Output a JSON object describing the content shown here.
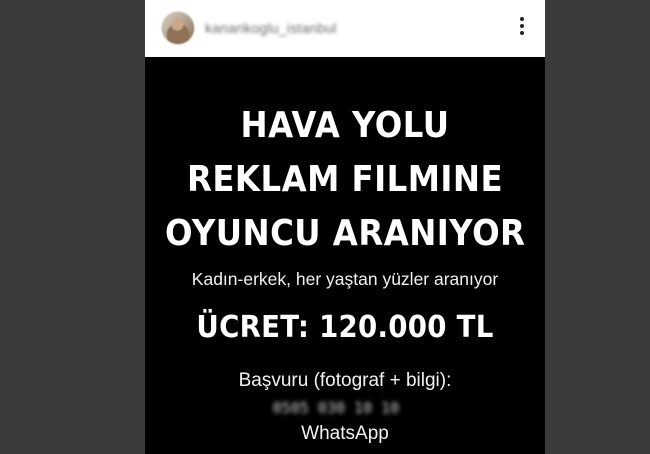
{
  "post": {
    "username": "kanarikoglu_istanbul",
    "menu_icon": "more-vertical-icon"
  },
  "ad": {
    "headline": [
      "HAVA YOLU",
      "REKLAM FILMINE",
      "OYUNCU ARANIYOR"
    ],
    "subtitle": "Kadın-erkek, her yaştan yüzler aranıyor",
    "price": "ÜCRET: 120.000 TL",
    "apply_label": "Başvuru (fotograf + bilgi):",
    "phone": "0505 030 10 10",
    "channel": "WhatsApp"
  },
  "colors": {
    "page_background": "#3a3b3c",
    "header_background": "#ffffff",
    "post_background": "#000000",
    "text": "#ffffff"
  }
}
